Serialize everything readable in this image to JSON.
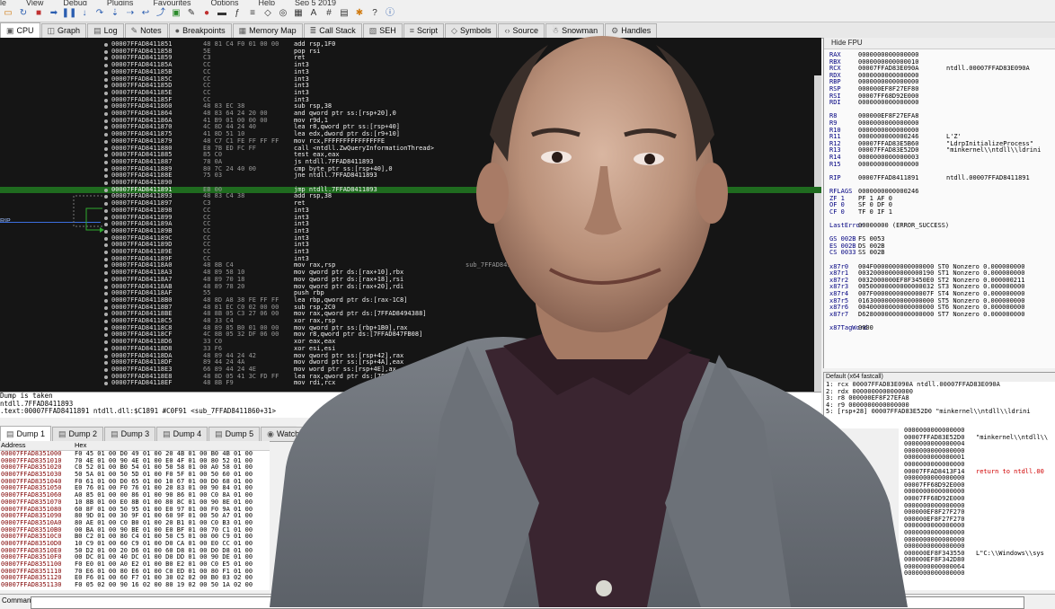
{
  "menubar": {
    "items": [
      "le",
      "View",
      "Debug",
      "Plugins",
      "Favourites",
      "Options",
      "Help",
      "Sep 5 2019"
    ]
  },
  "toolbar": {
    "icons": [
      "folder-icon",
      "restart-icon",
      "stop-icon",
      "run-icon",
      "pause-icon",
      "step-into-icon",
      "step-over-icon",
      "trace-into-icon",
      "trace-over-icon",
      "execute-till-return-icon",
      "run-to-user-code-icon",
      "patch-icon",
      "comment-icon",
      "label-icon",
      "bookmark-icon",
      "function-icon",
      "script-icon",
      "symbols-icon",
      "graph-icon",
      "hex-icon",
      "font-icon",
      "hash-icon",
      "calculator-icon",
      "settings-icon",
      "help-icon",
      "about-icon"
    ]
  },
  "main_tabs": [
    {
      "icon": "cpu-icon",
      "label": "CPU",
      "active": true
    },
    {
      "icon": "graph-icon",
      "label": "Graph"
    },
    {
      "icon": "log-icon",
      "label": "Log"
    },
    {
      "icon": "notes-icon",
      "label": "Notes"
    },
    {
      "icon": "breakpoint-icon",
      "label": "Breakpoints"
    },
    {
      "icon": "memory-icon",
      "label": "Memory Map"
    },
    {
      "icon": "callstack-icon",
      "label": "Call Stack"
    },
    {
      "icon": "seh-icon",
      "label": "SEH"
    },
    {
      "icon": "script-icon",
      "label": "Script"
    },
    {
      "icon": "symbols-icon",
      "label": "Symbols"
    },
    {
      "icon": "source-icon",
      "label": "Source"
    },
    {
      "icon": "snowman-icon",
      "label": "Snowman"
    },
    {
      "icon": "handles-icon",
      "label": "Handles"
    }
  ],
  "disasm": {
    "rip_label": "RIP",
    "rows": [
      {
        "addr": "00007FFAD8411851",
        "bytes": "48 81 C4 F0 01 00 00",
        "ins": "add rsp,1F0"
      },
      {
        "addr": "00007FFAD8411858",
        "bytes": "5E",
        "ins": "pop rsi"
      },
      {
        "addr": "00007FFAD8411859",
        "bytes": "C3",
        "ins": "ret"
      },
      {
        "addr": "00007FFAD841185A",
        "bytes": "CC",
        "ins": "int3"
      },
      {
        "addr": "00007FFAD841185B",
        "bytes": "CC",
        "ins": "int3"
      },
      {
        "addr": "00007FFAD841185C",
        "bytes": "CC",
        "ins": "int3"
      },
      {
        "addr": "00007FFAD841185D",
        "bytes": "CC",
        "ins": "int3"
      },
      {
        "addr": "00007FFAD841185E",
        "bytes": "CC",
        "ins": "int3"
      },
      {
        "addr": "00007FFAD841185F",
        "bytes": "CC",
        "ins": "int3"
      },
      {
        "addr": "00007FFAD8411860",
        "bytes": "48 83 EC 38",
        "ins": "sub rsp,38"
      },
      {
        "addr": "00007FFAD8411864",
        "bytes": "48 83 64 24 20 00",
        "ins": "and qword ptr ss:[rsp+20],0"
      },
      {
        "addr": "00007FFAD841186A",
        "bytes": "41 B9 01 00 00 00",
        "ins": "mov r9d,1"
      },
      {
        "addr": "00007FFAD8411870",
        "bytes": "4C 8D 44 24 40",
        "ins": "lea r8,qword ptr ss:[rsp+40]"
      },
      {
        "addr": "00007FFAD8411875",
        "bytes": "41 8D 51 10",
        "ins": "lea edx,dword ptr ds:[r9+10]"
      },
      {
        "addr": "00007FFAD8411879",
        "bytes": "48 C7 C1 FE FF FF FF",
        "ins": "mov rcx,FFFFFFFFFFFFFFFE"
      },
      {
        "addr": "00007FFAD8411880",
        "bytes": "E8 7B ED FC FF",
        "ins": "call <ntdll.ZwQueryInformationThread>"
      },
      {
        "addr": "00007FFAD8411885",
        "bytes": "85 C0",
        "ins": "test eax,eax"
      },
      {
        "addr": "00007FFAD8411887",
        "bytes": "78 0A",
        "ins": "js ntdll.7FFAD8411893"
      },
      {
        "addr": "00007FFAD8411889",
        "bytes": "80 7C 24 40 00",
        "ins": "cmp byte ptr ss:[rsp+40],0"
      },
      {
        "addr": "00007FFAD841188E",
        "bytes": "75 03",
        "ins": "jne ntdll.7FFAD8411893"
      },
      {
        "addr": "00007FFAD8411890",
        "bytes": "",
        "ins": ""
      },
      {
        "addr": "00007FFAD8411891",
        "bytes": "EB 00",
        "ins": "jmp ntdll.7FFAD8411893",
        "current": true
      },
      {
        "addr": "00007FFAD8411893",
        "bytes": "48 83 C4 38",
        "ins": "add rsp,38"
      },
      {
        "addr": "00007FFAD8411897",
        "bytes": "C3",
        "ins": "ret"
      },
      {
        "addr": "00007FFAD8411898",
        "bytes": "CC",
        "ins": "int3"
      },
      {
        "addr": "00007FFAD8411899",
        "bytes": "CC",
        "ins": "int3"
      },
      {
        "addr": "00007FFAD841189A",
        "bytes": "CC",
        "ins": "int3"
      },
      {
        "addr": "00007FFAD841189B",
        "bytes": "CC",
        "ins": "int3"
      },
      {
        "addr": "00007FFAD841189C",
        "bytes": "CC",
        "ins": "int3"
      },
      {
        "addr": "00007FFAD841189D",
        "bytes": "CC",
        "ins": "int3"
      },
      {
        "addr": "00007FFAD841189E",
        "bytes": "CC",
        "ins": "int3"
      },
      {
        "addr": "00007FFAD841189F",
        "bytes": "CC",
        "ins": "int3"
      },
      {
        "addr": "00007FFAD84118A0",
        "bytes": "48 8B C4",
        "ins": "mov rax,rsp",
        "comment": "sub_7FFAD84118A0"
      },
      {
        "addr": "00007FFAD84118A3",
        "bytes": "48 89 58 10",
        "ins": "mov qword ptr ds:[rax+10],rbx"
      },
      {
        "addr": "00007FFAD84118A7",
        "bytes": "48 89 70 18",
        "ins": "mov qword ptr ds:[rax+18],rsi"
      },
      {
        "addr": "00007FFAD84118AB",
        "bytes": "48 89 78 20",
        "ins": "mov qword ptr ds:[rax+20],rdi"
      },
      {
        "addr": "00007FFAD84118AF",
        "bytes": "55",
        "ins": "push rbp"
      },
      {
        "addr": "00007FFAD84118B0",
        "bytes": "48 8D A8 38 FE FF FF",
        "ins": "lea rbp,qword ptr ds:[rax-1C8]"
      },
      {
        "addr": "00007FFAD84118B7",
        "bytes": "48 81 EC C0 02 00 00",
        "ins": "sub rsp,2C0"
      },
      {
        "addr": "00007FFAD84118BE",
        "bytes": "48 8B 05 C3 27 06 00",
        "ins": "mov rax,qword ptr ds:[7FFAD8494388]"
      },
      {
        "addr": "00007FFAD84118C5",
        "bytes": "48 33 C4",
        "ins": "xor rax,rsp"
      },
      {
        "addr": "00007FFAD84118C8",
        "bytes": "48 89 85 B0 01 00 00",
        "ins": "mov qword ptr ss:[rbp+1B0],rax"
      },
      {
        "addr": "00007FFAD84118CF",
        "bytes": "4C 8B 05 32 DF 06 00",
        "ins": "mov r8,qword ptr ds:[7FFAD847FB08]"
      },
      {
        "addr": "00007FFAD84118D6",
        "bytes": "33 C0",
        "ins": "xor eax,eax"
      },
      {
        "addr": "00007FFAD84118D8",
        "bytes": "33 F6",
        "ins": "xor esi,esi"
      },
      {
        "addr": "00007FFAD84118DA",
        "bytes": "48 89 44 24 42",
        "ins": "mov qword ptr ss:[rsp+42],rax"
      },
      {
        "addr": "00007FFAD84118DF",
        "bytes": "89 44 24 4A",
        "ins": "mov dword ptr ss:[rsp+4A],eax"
      },
      {
        "addr": "00007FFAD84118E3",
        "bytes": "66 89 44 24 4E",
        "ins": "mov word ptr ss:[rsp+4E],ax"
      },
      {
        "addr": "00007FFAD84118E8",
        "bytes": "48 8D 05 41 3C FD FF",
        "ins": "lea rax,qword ptr ds:[7FFAD83E5830]"
      },
      {
        "addr": "00007FFAD84118EF",
        "bytes": "48 8B F9",
        "ins": "mov rdi,rcx"
      }
    ]
  },
  "info": {
    "line1": "Dump is taken",
    "line2": "ntdll.7FFAD8411893",
    "line3": ".text:00007FFAD8411891 ntdll.dll:$C1891 #C0F91 <sub_7FFAD8411860+31>"
  },
  "registers": {
    "header": "Hide FPU",
    "rows": [
      {
        "n": "RAX",
        "v": "0000000000000000"
      },
      {
        "n": "RBX",
        "v": "0000000000000010"
      },
      {
        "n": "RCX",
        "v": "00007FFAD83E090A",
        "c": "ntdll.00007FFAD83E090A"
      },
      {
        "n": "RDX",
        "v": "0000000000000000"
      },
      {
        "n": "RBP",
        "v": "0000000000000000"
      },
      {
        "n": "RSP",
        "v": "000000EF8F27EF80"
      },
      {
        "n": "RSI",
        "v": "00007FF68D92E000"
      },
      {
        "n": "RDI",
        "v": "0000000000000000"
      },
      {
        "n": "",
        "v": ""
      },
      {
        "n": "R8",
        "v": "000000EF8F27EFA8"
      },
      {
        "n": "R9",
        "v": "0000000000000000"
      },
      {
        "n": "R10",
        "v": "0000000000000000"
      },
      {
        "n": "R11",
        "v": "0000000000000246",
        "c": "L'Z'"
      },
      {
        "n": "R12",
        "v": "00007FFAD83E5B60",
        "c": "\"LdrpInitializeProcess\""
      },
      {
        "n": "R13",
        "v": "00007FFAD83E52D0",
        "c": "\"minkernel\\\\ntdll\\\\ldrini"
      },
      {
        "n": "R14",
        "v": "0000000000000003"
      },
      {
        "n": "R15",
        "v": "0000000000000000"
      },
      {
        "n": "",
        "v": ""
      },
      {
        "n": "RIP",
        "v": "00007FFAD8411891",
        "c": "ntdll.00007FFAD8411891"
      },
      {
        "n": "",
        "v": ""
      },
      {
        "n": "RFLAGS",
        "v": "0000000000000246"
      },
      {
        "n": "ZF 1",
        "v": "PF 1  AF 0"
      },
      {
        "n": "OF 0",
        "v": "SF 0  DF 0"
      },
      {
        "n": "CF 0",
        "v": "TF 0  IF 1"
      },
      {
        "n": "",
        "v": ""
      },
      {
        "n": "LastError",
        "v": "00000000 (ERROR_SUCCESS)"
      },
      {
        "n": "",
        "v": ""
      },
      {
        "n": "GS 002B",
        "v": "FS 0053"
      },
      {
        "n": "ES 002B",
        "v": "DS 002B"
      },
      {
        "n": "CS 0033",
        "v": "SS 002B"
      },
      {
        "n": "",
        "v": ""
      },
      {
        "n": "x87r0",
        "v": "004F0000000000000000 ST0 Nonzero 0.000000000"
      },
      {
        "n": "x87r1",
        "v": "00320000000000000190 ST1 Nonzero 0.000000000"
      },
      {
        "n": "x87r2",
        "v": "0032000000EF8F3450E0 ST2 Nonzero 0.000000211"
      },
      {
        "n": "x87r3",
        "v": "00500000000000000032 ST3 Nonzero 0.000000000"
      },
      {
        "n": "x87r4",
        "v": "007F000000000000007F ST4 Nonzero 0.000000000"
      },
      {
        "n": "x87r5",
        "v": "01630000000000000000 ST5 Nonzero 0.000000000"
      },
      {
        "n": "x87r6",
        "v": "00400000000000000000 ST6 Nonzero 0.000000000"
      },
      {
        "n": "x87r7",
        "v": "D6280000000000000000 ST7 Nonzero 0.000000000"
      },
      {
        "n": "",
        "v": ""
      },
      {
        "n": "x87TagWord",
        "v": "0000"
      }
    ]
  },
  "callconv": {
    "header": "Default (x64 fastcall)",
    "rows": [
      "1: rcx 00007FFAD83E090A ntdll.00007FFAD83E090A",
      "2: rdx 0000000000000000",
      "3: r8 000000EF8F27EFA8",
      "4: r9 0000000000000000",
      "5: [rsp+28] 00007FFAD83E52D0 \"minkernel\\\\ntdll\\\\ldrini"
    ]
  },
  "dump_tabs": [
    {
      "label": "Dump 1",
      "active": true
    },
    {
      "label": "Dump 2"
    },
    {
      "label": "Dump 3"
    },
    {
      "label": "Dump 4"
    },
    {
      "label": "Dump 5"
    },
    {
      "label": "Watch 1"
    }
  ],
  "dump": {
    "col_address": "Address",
    "col_hex": "Hex",
    "rows": [
      {
        "a": "00007FFAD8351000",
        "h": "F0 45 01 00 D0 49 01 00 20 4B 01 00 B0 4B 01 00"
      },
      {
        "a": "00007FFAD8351010",
        "h": "70 4E 01 00 90 4E 01 00 E0 4F 01 00 80 52 01 00"
      },
      {
        "a": "00007FFAD8351020",
        "h": "C0 52 01 00 B0 54 01 00 50 58 01 00 A0 58 01 00"
      },
      {
        "a": "00007FFAD8351030",
        "h": "50 5A 01 00 50 5D 01 00 F0 5F 01 00 50 60 01 00"
      },
      {
        "a": "00007FFAD8351040",
        "h": "F0 61 01 00 D0 65 01 00 10 67 01 00 D0 68 01 00"
      },
      {
        "a": "00007FFAD8351050",
        "h": "E0 76 01 00 F0 76 01 00 20 83 01 00 90 84 01 00"
      },
      {
        "a": "00007FFAD8351060",
        "h": "A0 85 01 00 00 86 01 00 90 86 01 00 C0 8A 01 00"
      },
      {
        "a": "00007FFAD8351070",
        "h": "10 8B 01 00 E0 8B 01 00 80 8C 01 00 90 8E 01 00"
      },
      {
        "a": "00007FFAD8351080",
        "h": "60 8F 01 00 50 95 01 00 E0 97 01 00 F0 9A 01 00"
      },
      {
        "a": "00007FFAD8351090",
        "h": "80 9D 01 00 30 9F 01 00 60 9F 01 00 50 A7 01 00"
      },
      {
        "a": "00007FFAD83510A0",
        "h": "80 AE 01 00 C0 B0 01 00 20 B1 01 00 C0 B3 01 00"
      },
      {
        "a": "00007FFAD83510B0",
        "h": "00 BA 01 00 90 BE 01 00 E0 BF 01 00 70 C1 01 00"
      },
      {
        "a": "00007FFAD83510C0",
        "h": "B0 C2 01 00 80 C4 01 00 50 C5 01 00 00 C9 01 00"
      },
      {
        "a": "00007FFAD83510D0",
        "h": "10 C9 01 00 60 C9 01 00 D0 CA 01 00 E0 CC 01 00"
      },
      {
        "a": "00007FFAD83510E0",
        "h": "50 D2 01 00 20 D6 01 00 60 D8 01 00 D0 D8 01 00"
      },
      {
        "a": "00007FFAD83510F0",
        "h": "00 DC 01 00 40 DC 01 00 D0 DD 01 00 90 DE 01 00"
      },
      {
        "a": "00007FFAD8351100",
        "h": "F0 E0 01 00 A0 E2 01 00 B0 E2 01 00 C0 E5 01 00"
      },
      {
        "a": "00007FFAD8351110",
        "h": "70 E6 01 00 80 E6 01 00 C0 ED 01 00 80 F1 01 00"
      },
      {
        "a": "00007FFAD8351120",
        "h": "E0 F6 01 00 60 F7 01 00 30 02 02 00 B0 03 02 00"
      },
      {
        "a": "00007FFAD8351130",
        "h": "F0 05 02 00 90 16 02 00 80 19 02 00 50 1A 02 00"
      }
    ]
  },
  "stack": {
    "rows": [
      {
        "v": "0000000000000000",
        "c": ""
      },
      {
        "v": "00007FFAD83E52D0",
        "c": "\"minkernel\\\\ntdll\\\\"
      },
      {
        "v": "0000000000000004",
        "c": ""
      },
      {
        "v": "0000000000000000",
        "c": ""
      },
      {
        "v": "0000000000000001",
        "c": ""
      },
      {
        "v": "0000000000000000",
        "c": ""
      },
      {
        "v": "00007FFAD8413F14",
        "c": "return to ntdll.00",
        "red": true
      },
      {
        "v": "0000000000000000",
        "c": ""
      },
      {
        "v": "00007FF68D92E000",
        "c": ""
      },
      {
        "v": "0000000000000000",
        "c": ""
      },
      {
        "v": "00007FF68D92E000",
        "c": ""
      },
      {
        "v": "0000000000000000",
        "c": ""
      },
      {
        "v": "000000EF8F27F270",
        "c": ""
      },
      {
        "v": "000000EF8F27F270",
        "c": ""
      },
      {
        "v": "0000000000000000",
        "c": ""
      },
      {
        "v": "0000000000000000",
        "c": ""
      },
      {
        "v": "0000000000000000",
        "c": ""
      },
      {
        "v": "0000000000000000",
        "c": ""
      },
      {
        "v": "000000EF8F343550",
        "c": "L\"C:\\\\Windows\\\\sys"
      },
      {
        "v": "000000EF8F342D80",
        "c": ""
      },
      {
        "v": "0000000000000064",
        "c": ""
      },
      {
        "v": "0000000000000000",
        "c": ""
      }
    ]
  },
  "command": {
    "label": "Command:",
    "value": ""
  }
}
